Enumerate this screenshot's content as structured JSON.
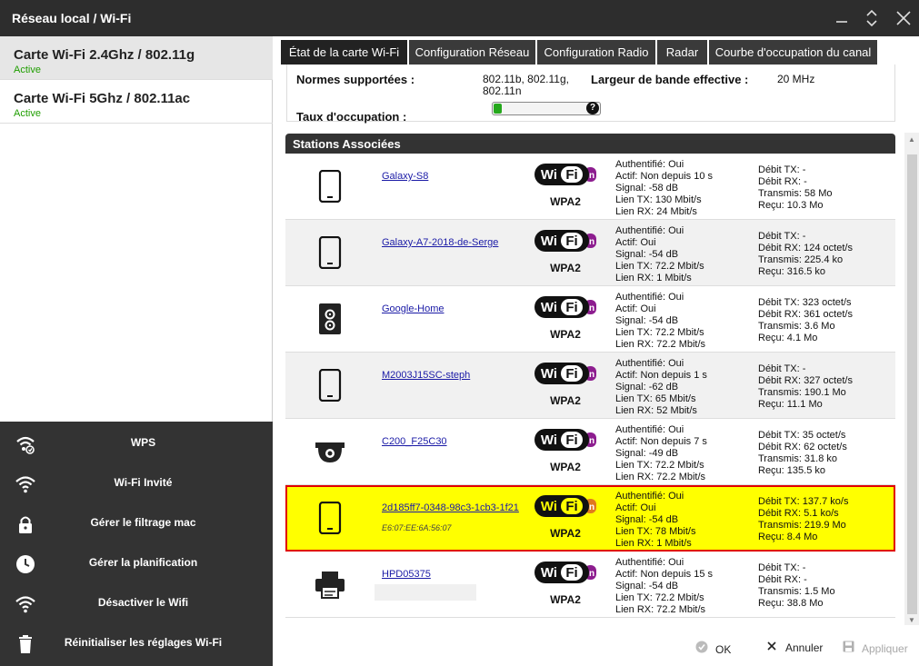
{
  "window": {
    "title": "Réseau local / Wi-Fi"
  },
  "cards": [
    {
      "name": "Carte Wi-Fi 2.4Ghz / 802.11g",
      "status": "Active"
    },
    {
      "name": "Carte Wi-Fi 5Ghz / 802.11ac",
      "status": "Active"
    }
  ],
  "actions": [
    {
      "label": "WPS",
      "icon": "wifi-wps-icon"
    },
    {
      "label": "Wi-Fi Invité",
      "icon": "wifi-guest-icon"
    },
    {
      "label": "Gérer le filtrage mac",
      "icon": "lock-icon"
    },
    {
      "label": "Gérer la planification",
      "icon": "clock-icon"
    },
    {
      "label": "Désactiver le Wifi",
      "icon": "wifi-icon"
    },
    {
      "label": "Réinitialiser les réglages Wi-Fi",
      "icon": "trash-icon"
    }
  ],
  "tabs": [
    {
      "label": "État de la carte Wi-Fi",
      "active": true
    },
    {
      "label": "Configuration Réseau"
    },
    {
      "label": "Configuration Radio"
    },
    {
      "label": "Radar"
    },
    {
      "label": "Courbe d'occupation du canal"
    }
  ],
  "info": {
    "normes_label": "Normes supportées :",
    "normes_value_line1": "802.11b, 802.11g,",
    "normes_value_line2": "802.11n",
    "largeur_label": "Largeur de bande effective :",
    "largeur_value": "20 MHz",
    "taux_label": "Taux d'occupation :",
    "taux_fraction": 0.08,
    "help": "?"
  },
  "section": {
    "title": "Stations Associées"
  },
  "wifi_logo": {
    "text_wi": "Wi",
    "text_fi": "Fi",
    "text_n": "n",
    "colors": {
      "black": "#111111",
      "purple": "#8d1d8f",
      "orange": "#e07a1f"
    }
  },
  "stations": [
    {
      "name": "Galaxy-S8",
      "mac": "",
      "icon": "smartphone-icon",
      "security": "WPA2",
      "info": [
        "Authentifié: Oui",
        "Actif: Non depuis 10 s",
        "Signal: -58 dB",
        "Lien TX: 130 Mbit/s",
        "Lien RX: 24 Mbit/s"
      ],
      "stats": [
        "Débit TX: -",
        "Débit RX: -",
        "Transmis: 58 Mo",
        "Reçu: 10.3 Mo"
      ]
    },
    {
      "name": "Galaxy-A7-2018-de-Serge",
      "mac": "",
      "icon": "smartphone-icon",
      "security": "WPA2",
      "info": [
        "Authentifié: Oui",
        "Actif: Oui",
        "Signal: -54 dB",
        "Lien TX: 72.2 Mbit/s",
        "Lien RX: 1 Mbit/s"
      ],
      "stats": [
        "Débit TX: -",
        "Débit RX: 124 octet/s",
        "Transmis: 225.4 ko",
        "Reçu: 316.5 ko"
      ]
    },
    {
      "name": "Google-Home",
      "mac": "",
      "icon": "speaker-icon",
      "security": "WPA2",
      "info": [
        "Authentifié: Oui",
        "Actif: Oui",
        "Signal: -54 dB",
        "Lien TX: 72.2 Mbit/s",
        "Lien RX: 72.2 Mbit/s"
      ],
      "stats": [
        "Débit TX: 323 octet/s",
        "Débit RX: 361 octet/s",
        "Transmis: 3.6 Mo",
        "Reçu: 4.1 Mo"
      ]
    },
    {
      "name": "M2003J15SC-steph",
      "mac": "",
      "icon": "smartphone-icon",
      "security": "WPA2",
      "info": [
        "Authentifié: Oui",
        "Actif: Non depuis 1 s",
        "Signal: -62 dB",
        "Lien TX: 65 Mbit/s",
        "Lien RX: 52 Mbit/s"
      ],
      "stats": [
        "Débit TX: -",
        "Débit RX: 327 octet/s",
        "Transmis: 190.1 Mo",
        "Reçu: 11.1 Mo"
      ]
    },
    {
      "name": "C200_F25C30",
      "mac": "",
      "icon": "camera-icon",
      "security": "WPA2",
      "info": [
        "Authentifié: Oui",
        "Actif: Non depuis 7 s",
        "Signal: -49 dB",
        "Lien TX: 72.2 Mbit/s",
        "Lien RX: 72.2 Mbit/s"
      ],
      "stats": [
        "Débit TX: 35 octet/s",
        "Débit RX: 62 octet/s",
        "Transmis: 31.8 ko",
        "Reçu: 135.5 ko"
      ]
    },
    {
      "name": "2d185ff7-0348-98c3-1cb3-1f21",
      "mac": "E6:07:EE:6A:56:07",
      "icon": "smartphone-icon",
      "security": "WPA2",
      "info": [
        "Authentifié: Oui",
        "Actif: Oui",
        "Signal: -54 dB",
        "Lien TX: 78 Mbit/s",
        "Lien RX: 1 Mbit/s"
      ],
      "stats": [
        "Débit TX: 137.7 ko/s",
        "Débit RX: 5.1 ko/s",
        "Transmis: 219.9 Mo",
        "Reçu: 8.4 Mo"
      ]
    },
    {
      "name": "HPD05375",
      "mac": "",
      "icon": "printer-icon",
      "security": "WPA2",
      "info": [
        "Authentifié: Oui",
        "Actif: Non depuis 15 s",
        "Signal: -54 dB",
        "Lien TX: 72.2 Mbit/s",
        "Lien RX: 72.2 Mbit/s"
      ],
      "stats": [
        "Débit TX: -",
        "Débit RX: -",
        "Transmis: 1.5 Mo",
        "Reçu: 38.8 Mo"
      ]
    }
  ],
  "footer": {
    "ok": "OK",
    "cancel": "Annuler",
    "apply": "Appliquer"
  }
}
